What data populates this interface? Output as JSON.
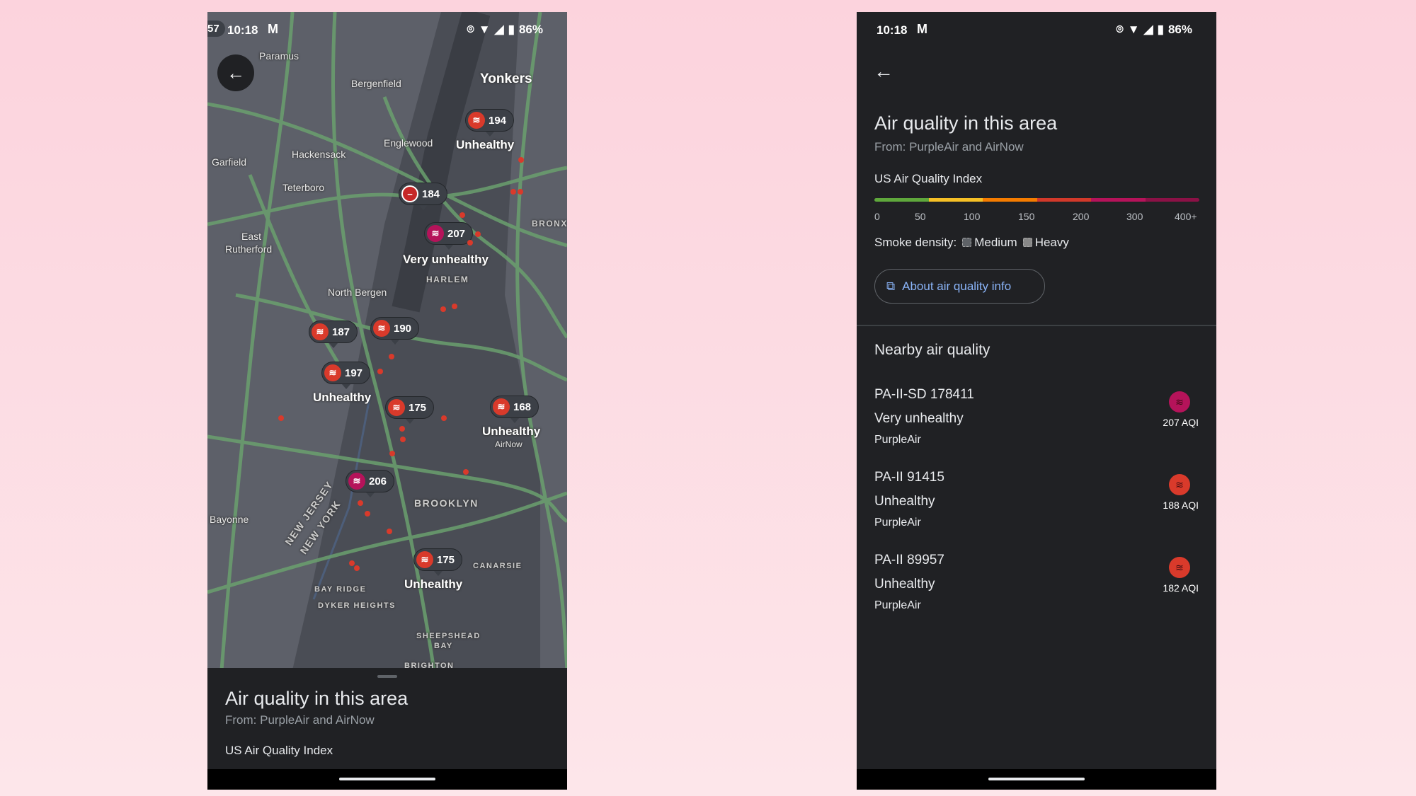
{
  "status_bar": {
    "time": "10:18",
    "battery": "86%",
    "left_badge": "57"
  },
  "colors": {
    "unhealthy": "#d93a2b",
    "very_unhealthy": "#b5135a",
    "link": "#8ab4f8",
    "aqi_scale": [
      "#5fa83c",
      "#f6c026",
      "#f57c00",
      "#d2392a",
      "#b5135a",
      "#8b1146"
    ]
  },
  "map": {
    "places": [
      "Paramus",
      "Bergenfield",
      "Englewood",
      "Hackensack",
      "Garfield",
      "Teterboro",
      "East",
      "Rutherford",
      "North Bergen",
      "Bayonne",
      "Yonkers",
      "NEW JERSEY",
      "NEW YORK"
    ],
    "districts": [
      "HARLEM",
      "BRONX",
      "BROOKLYN",
      "CANARSIE",
      "BAY RIDGE",
      "DYKER HEIGHTS",
      "SHEEPSHEAD",
      "BAY",
      "BRIGHTON"
    ],
    "status_labels": [
      "Unhealthy",
      "Very unhealthy",
      "Unhealthy",
      "Unhealthy",
      "Unhealthy"
    ],
    "airnow": "AirNow",
    "markers": [
      {
        "value": "194",
        "level": "unhealthy",
        "icon": "smoke-icon"
      },
      {
        "value": "184",
        "level": "unhealthy",
        "icon": "no-entry-icon"
      },
      {
        "value": "207",
        "level": "very_unhealthy",
        "icon": "smoke-icon"
      },
      {
        "value": "190",
        "level": "unhealthy",
        "icon": "smoke-icon"
      },
      {
        "value": "187",
        "level": "unhealthy",
        "icon": "smoke-icon"
      },
      {
        "value": "197",
        "level": "unhealthy",
        "icon": "smoke-icon"
      },
      {
        "value": "175",
        "level": "unhealthy",
        "icon": "smoke-icon"
      },
      {
        "value": "168",
        "level": "unhealthy",
        "icon": "smoke-icon"
      },
      {
        "value": "206",
        "level": "very_unhealthy",
        "icon": "smoke-icon"
      },
      {
        "value": "175",
        "level": "unhealthy",
        "icon": "smoke-icon"
      }
    ]
  },
  "sheet": {
    "title": "Air quality in this area",
    "source": "From: PurpleAir and AirNow",
    "index_label": "US Air Quality Index"
  },
  "detail": {
    "title": "Air quality in this area",
    "source": "From: PurpleAir and AirNow",
    "index_label": "US Air Quality Index",
    "scale_ticks": [
      "0",
      "50",
      "100",
      "150",
      "200",
      "300",
      "400+"
    ],
    "smoke_label": "Smoke density:",
    "smoke_medium": "Medium",
    "smoke_heavy": "Heavy",
    "about_button": "About air quality info",
    "nearby_title": "Nearby air quality",
    "nearby": [
      {
        "name": "PA-II-SD 178411",
        "status": "Very unhealthy",
        "source": "PurpleAir",
        "aqi": "207 AQI",
        "level": "very_unhealthy"
      },
      {
        "name": "PA-II 91415",
        "status": "Unhealthy",
        "source": "PurpleAir",
        "aqi": "188 AQI",
        "level": "unhealthy"
      },
      {
        "name": "PA-II 89957",
        "status": "Unhealthy",
        "source": "PurpleAir",
        "aqi": "182 AQI",
        "level": "unhealthy"
      }
    ]
  }
}
